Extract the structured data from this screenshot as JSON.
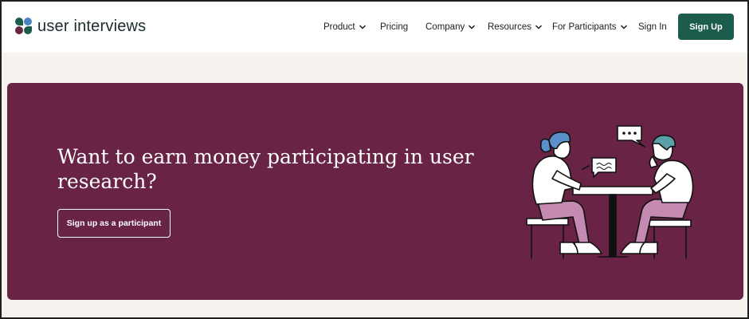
{
  "brand": {
    "name": "user interviews",
    "colors": {
      "teal": "#1b5c4d",
      "plum": "#682345",
      "blue": "#4a83c4"
    }
  },
  "nav": {
    "items": [
      {
        "label": "Product",
        "has_dropdown": true,
        "icon": "chevron-down-icon"
      },
      {
        "label": "Pricing",
        "has_dropdown": false
      },
      {
        "label": "Company",
        "has_dropdown": true,
        "icon": "chevron-down-icon"
      },
      {
        "label": "Resources",
        "has_dropdown": true,
        "icon": "chevron-down-icon"
      },
      {
        "label": "For Participants",
        "has_dropdown": true,
        "icon": "chevron-down-icon"
      },
      {
        "label": "Sign In",
        "has_dropdown": false
      }
    ],
    "signup_label": "Sign Up"
  },
  "hero": {
    "headline": "Want to earn money participating in user research?",
    "cta_label": "Sign up as a participant",
    "background": "#682345",
    "illustration": "two-people-conversation-illustration"
  }
}
